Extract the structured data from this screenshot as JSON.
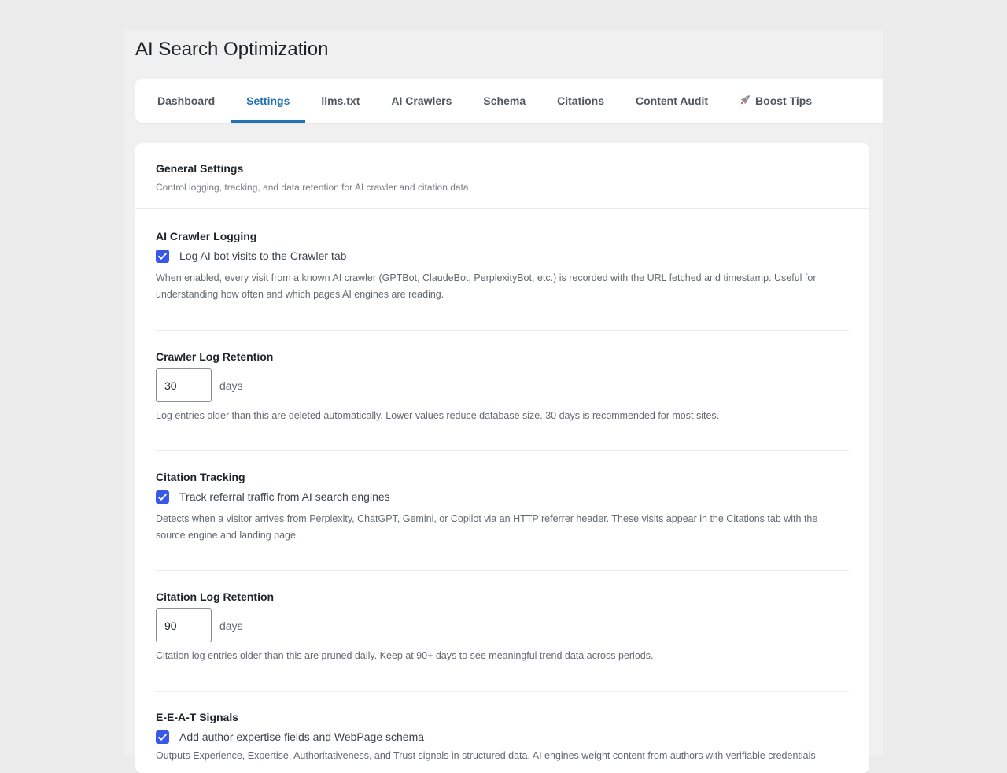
{
  "page": {
    "title": "AI Search Optimization"
  },
  "tabs": [
    {
      "label": "Dashboard"
    },
    {
      "label": "Settings"
    },
    {
      "label": "llms.txt"
    },
    {
      "label": "AI Crawlers"
    },
    {
      "label": "Schema"
    },
    {
      "label": "Citations"
    },
    {
      "label": "Content Audit"
    },
    {
      "label": "Boost Tips",
      "icon": "rocket-icon"
    }
  ],
  "active_tab": "Settings",
  "card": {
    "title": "General Settings",
    "subtitle": "Control logging, tracking, and data retention for AI crawler and citation data."
  },
  "settings": {
    "crawler_logging": {
      "label": "AI Crawler Logging",
      "checkbox_label": "Log AI bot visits to the Crawler tab",
      "checked": true,
      "description": "When enabled, every visit from a known AI crawler (GPTBot, ClaudeBot, PerplexityBot, etc.) is recorded with the URL fetched and timestamp. Useful for understanding how often and which pages AI engines are reading."
    },
    "crawler_retention": {
      "label": "Crawler Log Retention",
      "value": "30",
      "unit": "days",
      "description": "Log entries older than this are deleted automatically. Lower values reduce database size. 30 days is recommended for most sites."
    },
    "citation_tracking": {
      "label": "Citation Tracking",
      "checkbox_label": "Track referral traffic from AI search engines",
      "checked": true,
      "description": "Detects when a visitor arrives from Perplexity, ChatGPT, Gemini, or Copilot via an HTTP referrer header. These visits appear in the Citations tab with the source engine and landing page."
    },
    "citation_retention": {
      "label": "Citation Log Retention",
      "value": "90",
      "unit": "days",
      "description": "Citation log entries older than this are pruned daily. Keep at 90+ days to see meaningful trend data across periods."
    },
    "eeat": {
      "label": "E-E-A-T Signals",
      "checkbox_label": "Add author expertise fields and WebPage schema",
      "checked": true,
      "description": "Outputs Experience, Expertise, Authoritativeness, and Trust signals in structured data. AI engines weight content from authors with verifiable credentials"
    }
  },
  "colors": {
    "accent": "#2271b1",
    "checkbox": "#3858e9",
    "background": "#ececec"
  }
}
